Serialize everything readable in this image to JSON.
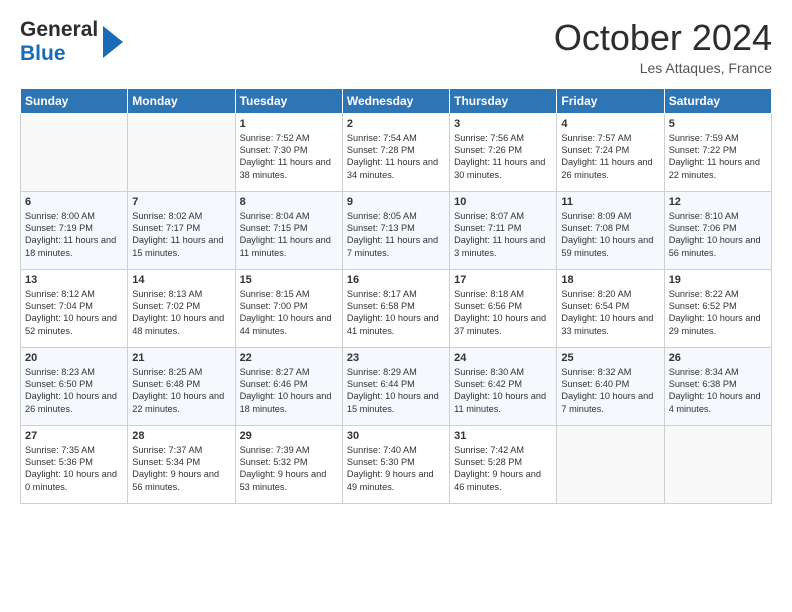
{
  "header": {
    "logo_line1": "General",
    "logo_line2": "Blue",
    "month": "October 2024",
    "location": "Les Attaques, France"
  },
  "weekdays": [
    "Sunday",
    "Monday",
    "Tuesday",
    "Wednesday",
    "Thursday",
    "Friday",
    "Saturday"
  ],
  "rows": [
    [
      {
        "day": "",
        "content": ""
      },
      {
        "day": "",
        "content": ""
      },
      {
        "day": "1",
        "content": "Sunrise: 7:52 AM\nSunset: 7:30 PM\nDaylight: 11 hours and 38 minutes."
      },
      {
        "day": "2",
        "content": "Sunrise: 7:54 AM\nSunset: 7:28 PM\nDaylight: 11 hours and 34 minutes."
      },
      {
        "day": "3",
        "content": "Sunrise: 7:56 AM\nSunset: 7:26 PM\nDaylight: 11 hours and 30 minutes."
      },
      {
        "day": "4",
        "content": "Sunrise: 7:57 AM\nSunset: 7:24 PM\nDaylight: 11 hours and 26 minutes."
      },
      {
        "day": "5",
        "content": "Sunrise: 7:59 AM\nSunset: 7:22 PM\nDaylight: 11 hours and 22 minutes."
      }
    ],
    [
      {
        "day": "6",
        "content": "Sunrise: 8:00 AM\nSunset: 7:19 PM\nDaylight: 11 hours and 18 minutes."
      },
      {
        "day": "7",
        "content": "Sunrise: 8:02 AM\nSunset: 7:17 PM\nDaylight: 11 hours and 15 minutes."
      },
      {
        "day": "8",
        "content": "Sunrise: 8:04 AM\nSunset: 7:15 PM\nDaylight: 11 hours and 11 minutes."
      },
      {
        "day": "9",
        "content": "Sunrise: 8:05 AM\nSunset: 7:13 PM\nDaylight: 11 hours and 7 minutes."
      },
      {
        "day": "10",
        "content": "Sunrise: 8:07 AM\nSunset: 7:11 PM\nDaylight: 11 hours and 3 minutes."
      },
      {
        "day": "11",
        "content": "Sunrise: 8:09 AM\nSunset: 7:08 PM\nDaylight: 10 hours and 59 minutes."
      },
      {
        "day": "12",
        "content": "Sunrise: 8:10 AM\nSunset: 7:06 PM\nDaylight: 10 hours and 56 minutes."
      }
    ],
    [
      {
        "day": "13",
        "content": "Sunrise: 8:12 AM\nSunset: 7:04 PM\nDaylight: 10 hours and 52 minutes."
      },
      {
        "day": "14",
        "content": "Sunrise: 8:13 AM\nSunset: 7:02 PM\nDaylight: 10 hours and 48 minutes."
      },
      {
        "day": "15",
        "content": "Sunrise: 8:15 AM\nSunset: 7:00 PM\nDaylight: 10 hours and 44 minutes."
      },
      {
        "day": "16",
        "content": "Sunrise: 8:17 AM\nSunset: 6:58 PM\nDaylight: 10 hours and 41 minutes."
      },
      {
        "day": "17",
        "content": "Sunrise: 8:18 AM\nSunset: 6:56 PM\nDaylight: 10 hours and 37 minutes."
      },
      {
        "day": "18",
        "content": "Sunrise: 8:20 AM\nSunset: 6:54 PM\nDaylight: 10 hours and 33 minutes."
      },
      {
        "day": "19",
        "content": "Sunrise: 8:22 AM\nSunset: 6:52 PM\nDaylight: 10 hours and 29 minutes."
      }
    ],
    [
      {
        "day": "20",
        "content": "Sunrise: 8:23 AM\nSunset: 6:50 PM\nDaylight: 10 hours and 26 minutes."
      },
      {
        "day": "21",
        "content": "Sunrise: 8:25 AM\nSunset: 6:48 PM\nDaylight: 10 hours and 22 minutes."
      },
      {
        "day": "22",
        "content": "Sunrise: 8:27 AM\nSunset: 6:46 PM\nDaylight: 10 hours and 18 minutes."
      },
      {
        "day": "23",
        "content": "Sunrise: 8:29 AM\nSunset: 6:44 PM\nDaylight: 10 hours and 15 minutes."
      },
      {
        "day": "24",
        "content": "Sunrise: 8:30 AM\nSunset: 6:42 PM\nDaylight: 10 hours and 11 minutes."
      },
      {
        "day": "25",
        "content": "Sunrise: 8:32 AM\nSunset: 6:40 PM\nDaylight: 10 hours and 7 minutes."
      },
      {
        "day": "26",
        "content": "Sunrise: 8:34 AM\nSunset: 6:38 PM\nDaylight: 10 hours and 4 minutes."
      }
    ],
    [
      {
        "day": "27",
        "content": "Sunrise: 7:35 AM\nSunset: 5:36 PM\nDaylight: 10 hours and 0 minutes."
      },
      {
        "day": "28",
        "content": "Sunrise: 7:37 AM\nSunset: 5:34 PM\nDaylight: 9 hours and 56 minutes."
      },
      {
        "day": "29",
        "content": "Sunrise: 7:39 AM\nSunset: 5:32 PM\nDaylight: 9 hours and 53 minutes."
      },
      {
        "day": "30",
        "content": "Sunrise: 7:40 AM\nSunset: 5:30 PM\nDaylight: 9 hours and 49 minutes."
      },
      {
        "day": "31",
        "content": "Sunrise: 7:42 AM\nSunset: 5:28 PM\nDaylight: 9 hours and 46 minutes."
      },
      {
        "day": "",
        "content": ""
      },
      {
        "day": "",
        "content": ""
      }
    ]
  ]
}
